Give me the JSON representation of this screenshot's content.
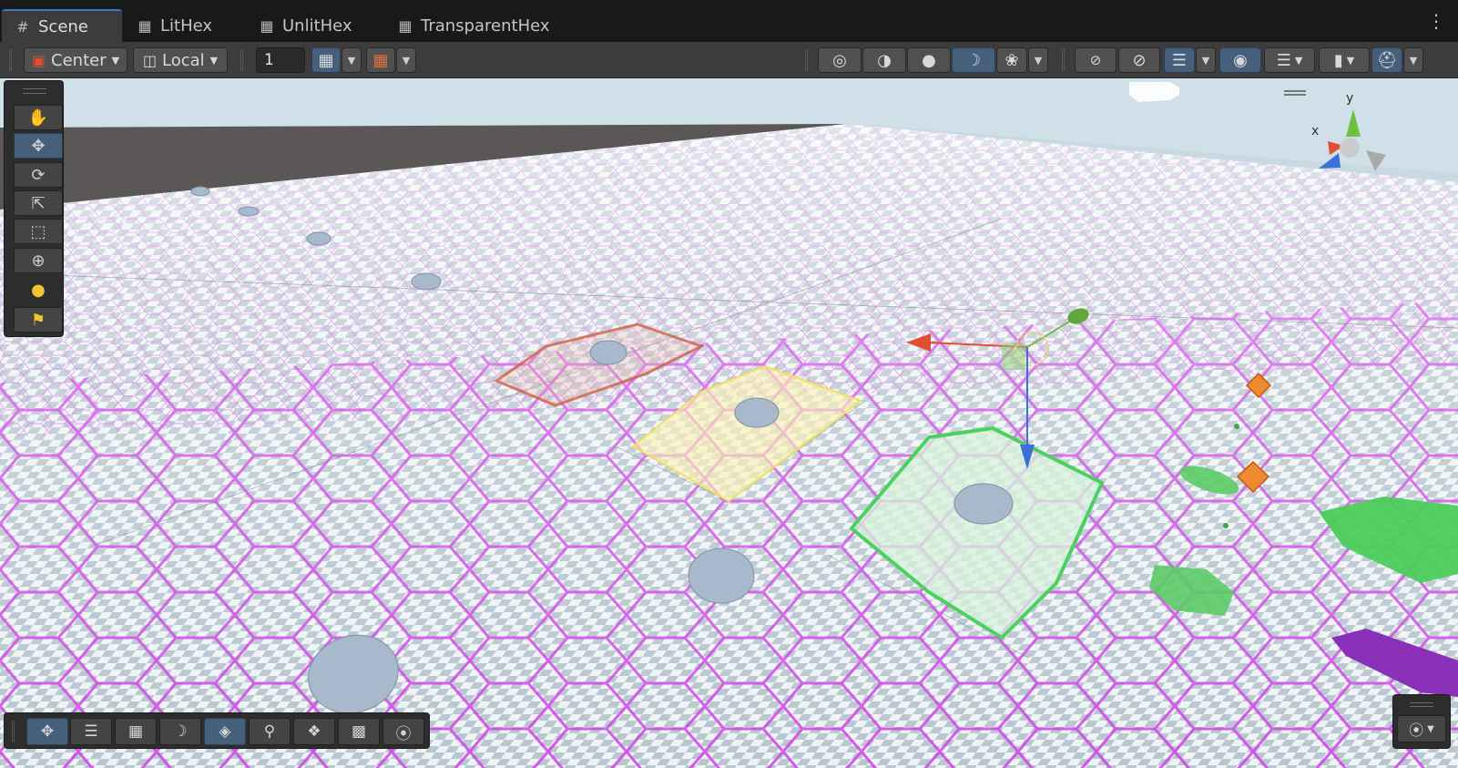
{
  "tabs": [
    {
      "label": "Scene",
      "icon": "grid-hash-icon",
      "active": true
    },
    {
      "label": "LitHex",
      "icon": "lock-icon",
      "active": false
    },
    {
      "label": "UnlitHex",
      "icon": "lock-icon",
      "active": false
    },
    {
      "label": "TransparentHex",
      "icon": "lock-icon",
      "active": false
    }
  ],
  "toolbar": {
    "pivot_mode": "Center",
    "pivot_rotation": "Local",
    "grid_size_value": "1"
  },
  "gizmo": {
    "x_label": "x",
    "y_label": "y"
  },
  "colors": {
    "accent": "#3a79bb",
    "selected_button": "#46607c",
    "hex_outline": "#e040f0",
    "hex_green": "#4cd060",
    "hex_yellow": "#f0e060",
    "hex_red": "#d06040",
    "axis_x": "#e05030",
    "axis_y": "#70c040",
    "axis_z": "#3a70d8"
  },
  "left_tools": [
    "hand-tool-icon",
    "move-tool-icon",
    "rotate-tool-icon",
    "scale-tool-icon",
    "rect-tool-icon",
    "transform-tool-icon",
    "light-bulb-icon",
    "light-probe-icon"
  ],
  "bottom_tools": [
    "move-overlay-icon",
    "sliders-icon",
    "grid-toggle-icon",
    "shading-icon",
    "layers-icon",
    "zoom-icon",
    "pivot-icon",
    "camera-icon",
    "compass-icon"
  ]
}
